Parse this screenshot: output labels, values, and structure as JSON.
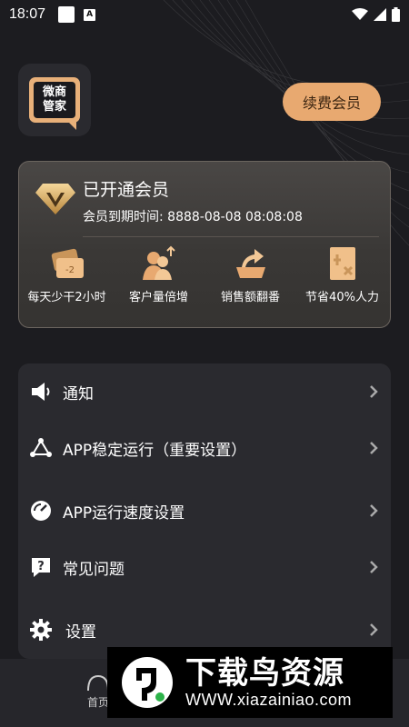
{
  "status_bar": {
    "time": "18:07",
    "notif_a": "A"
  },
  "logo": {
    "line1": "微商",
    "line2": "管家"
  },
  "header": {
    "renew_label": "续费会员"
  },
  "member": {
    "title": "已开通会员",
    "expiry": "会员到期时间: 8888-08-08 08:08:08",
    "benefits": [
      {
        "label": "每天少干2小时",
        "icon": "ticket-icon",
        "badge": "-2"
      },
      {
        "label": "客户量倍增",
        "icon": "customers-up-icon"
      },
      {
        "label": "销售额翻番",
        "icon": "sales-up-icon"
      },
      {
        "label": "节省40%人力",
        "icon": "manpower-icon"
      }
    ]
  },
  "menu": {
    "items": [
      {
        "label": "通知",
        "icon": "speaker-icon"
      },
      {
        "label": "APP稳定运行（重要设置）",
        "icon": "triangle-nodes-icon"
      },
      {
        "label": "APP运行速度设置",
        "icon": "speedometer-icon"
      },
      {
        "label": "常见问题",
        "icon": "faq-icon"
      },
      {
        "label": "设置",
        "icon": "gear-icon"
      }
    ]
  },
  "bottom_nav": {
    "home_label": "首页"
  },
  "watermark": {
    "title": "下载鸟资源",
    "url": "WWW.xiazainiao.com"
  },
  "colors": {
    "accent": "#e8a970",
    "background": "#1c1c20",
    "card": "#2a2a2f"
  }
}
